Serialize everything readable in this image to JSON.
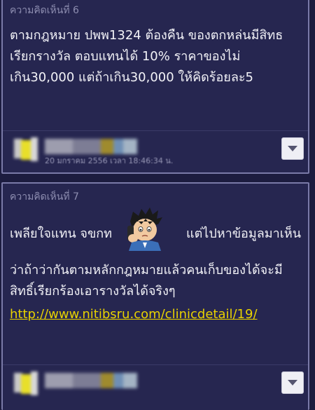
{
  "comments": [
    {
      "label": "ความคิดเห็นที่ 6",
      "lines": [
        "ตามกฎหมาย ปพพ1324 ต้องคืน ของตกหล่นมีสิทธ",
        "เรียกรางวัล ตอบแทนได้ 10% ราคาของไม่",
        "เกิน30,000 แต่ถ้าเกิน30,000 ให้คิดร้อยละ5"
      ],
      "date_partial": "20 มกราคม 2556 เวลา 18:46:34 น.",
      "menu_icon": "chevron-down-icon"
    },
    {
      "label": "ความคิดเห็นที่ 7",
      "line_a": "เพลียใจแทน จขกท",
      "line_b": "แต่ไปหาข้อมูลมาเห็น",
      "line_c": "ว่าถ้าว่ากันตามหลักกฎหมายแล้วคนเก็บของได้จะมี",
      "line_d": "สิทธิ์เรียกร้องเอารางวัลได้จริงๆ",
      "link": "http://www.nitibsru.com/clinicdetail/19/",
      "emoticon": "phone-call-emoticon",
      "menu_icon": "chevron-down-icon"
    }
  ],
  "colors": {
    "background": "#1c1c3f",
    "card": "#262650",
    "text": "#f2f2f7",
    "muted": "#8d8db0",
    "link": "#e8d200"
  }
}
